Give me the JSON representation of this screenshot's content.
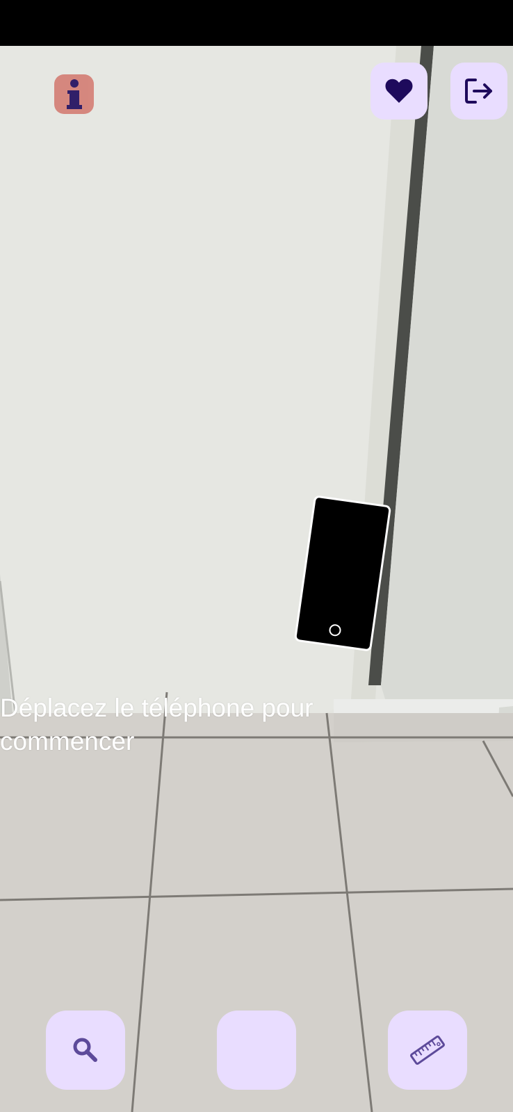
{
  "instruction": {
    "text": "Déplacez le téléphone pour commencer"
  },
  "top_bar": {
    "info_icon": "info-icon",
    "favorite_icon": "heart-icon",
    "exit_icon": "logout-icon"
  },
  "bottom_bar": {
    "search_icon": "magnifier-icon",
    "ruler_icon": "ruler-icon"
  },
  "colors": {
    "button_bg": "#e9ddff",
    "icon_color": "#1e0a5c",
    "icon_muted": "#5d4a9a",
    "info_bg": "#d47d74"
  }
}
